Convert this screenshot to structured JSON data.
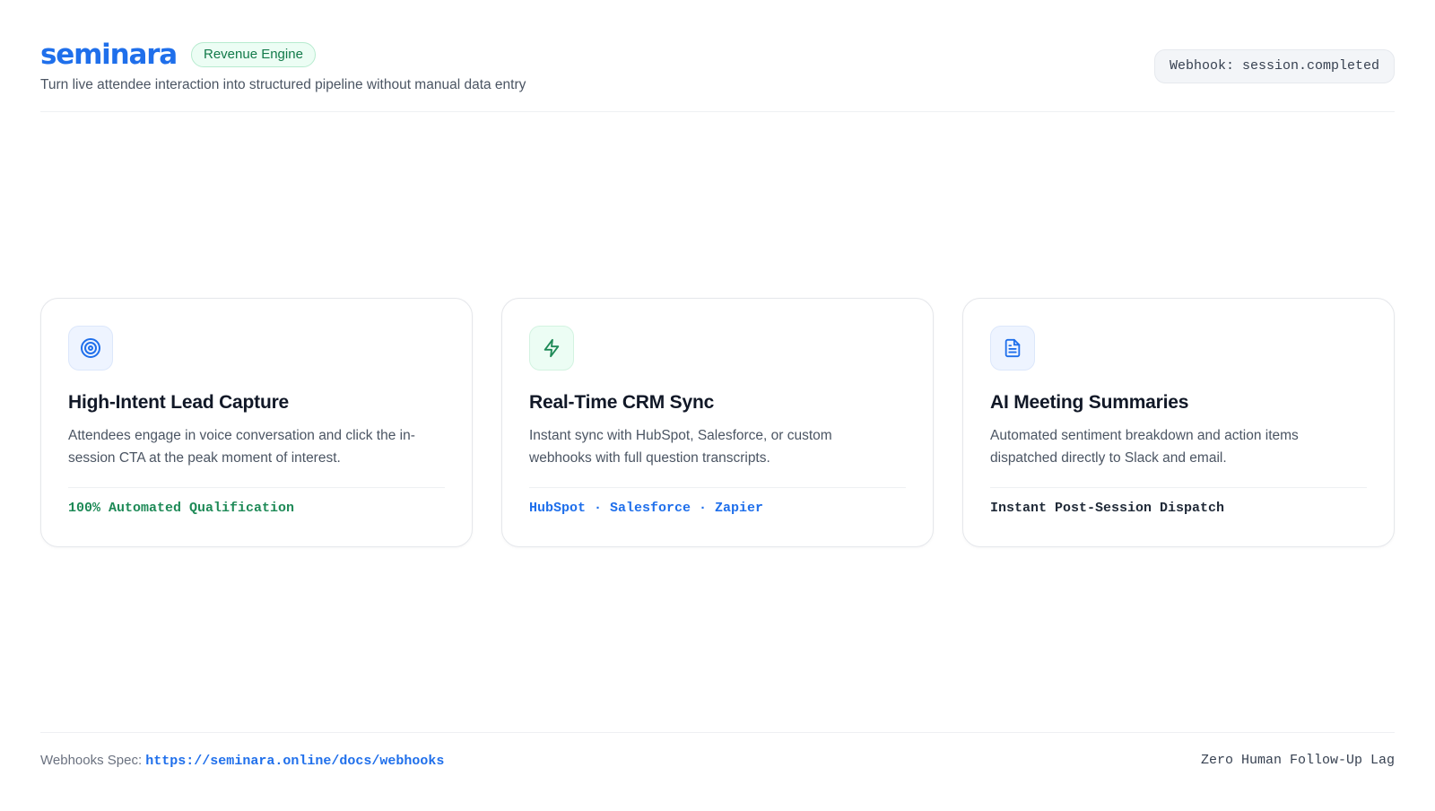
{
  "header": {
    "logo_text": "seminara",
    "badge": "Revenue Engine",
    "tagline": "Turn live attendee interaction into structured pipeline without manual data entry",
    "webhook_pill": "Webhook: session.completed"
  },
  "cards": [
    {
      "icon": "target-icon",
      "title": "High-Intent Lead Capture",
      "description": "Attendees engage in voice conversation and click the in-session CTA at the peak moment of interest.",
      "footnote": "100% Automated Qualification"
    },
    {
      "icon": "lightning-bolt-icon",
      "title": "Real-Time CRM Sync",
      "description": "Instant sync with HubSpot, Salesforce, or custom webhooks with full question transcripts.",
      "footnote": "HubSpot · Salesforce · Zapier"
    },
    {
      "icon": "document-icon",
      "title": "AI Meeting Summaries",
      "description": "Automated sentiment breakdown and action items dispatched directly to Slack and email.",
      "footnote": "Instant Post-Session Dispatch"
    }
  ],
  "footer": {
    "spec_label": "Webhooks Spec:",
    "spec_link": "https://seminara.online/docs/webhooks",
    "tagline": "Zero Human Follow-Up Lag"
  },
  "colors": {
    "brand_blue": "#1f6feb",
    "accent_green": "#1e8a57",
    "badge_bg": "#ecfdf4"
  }
}
